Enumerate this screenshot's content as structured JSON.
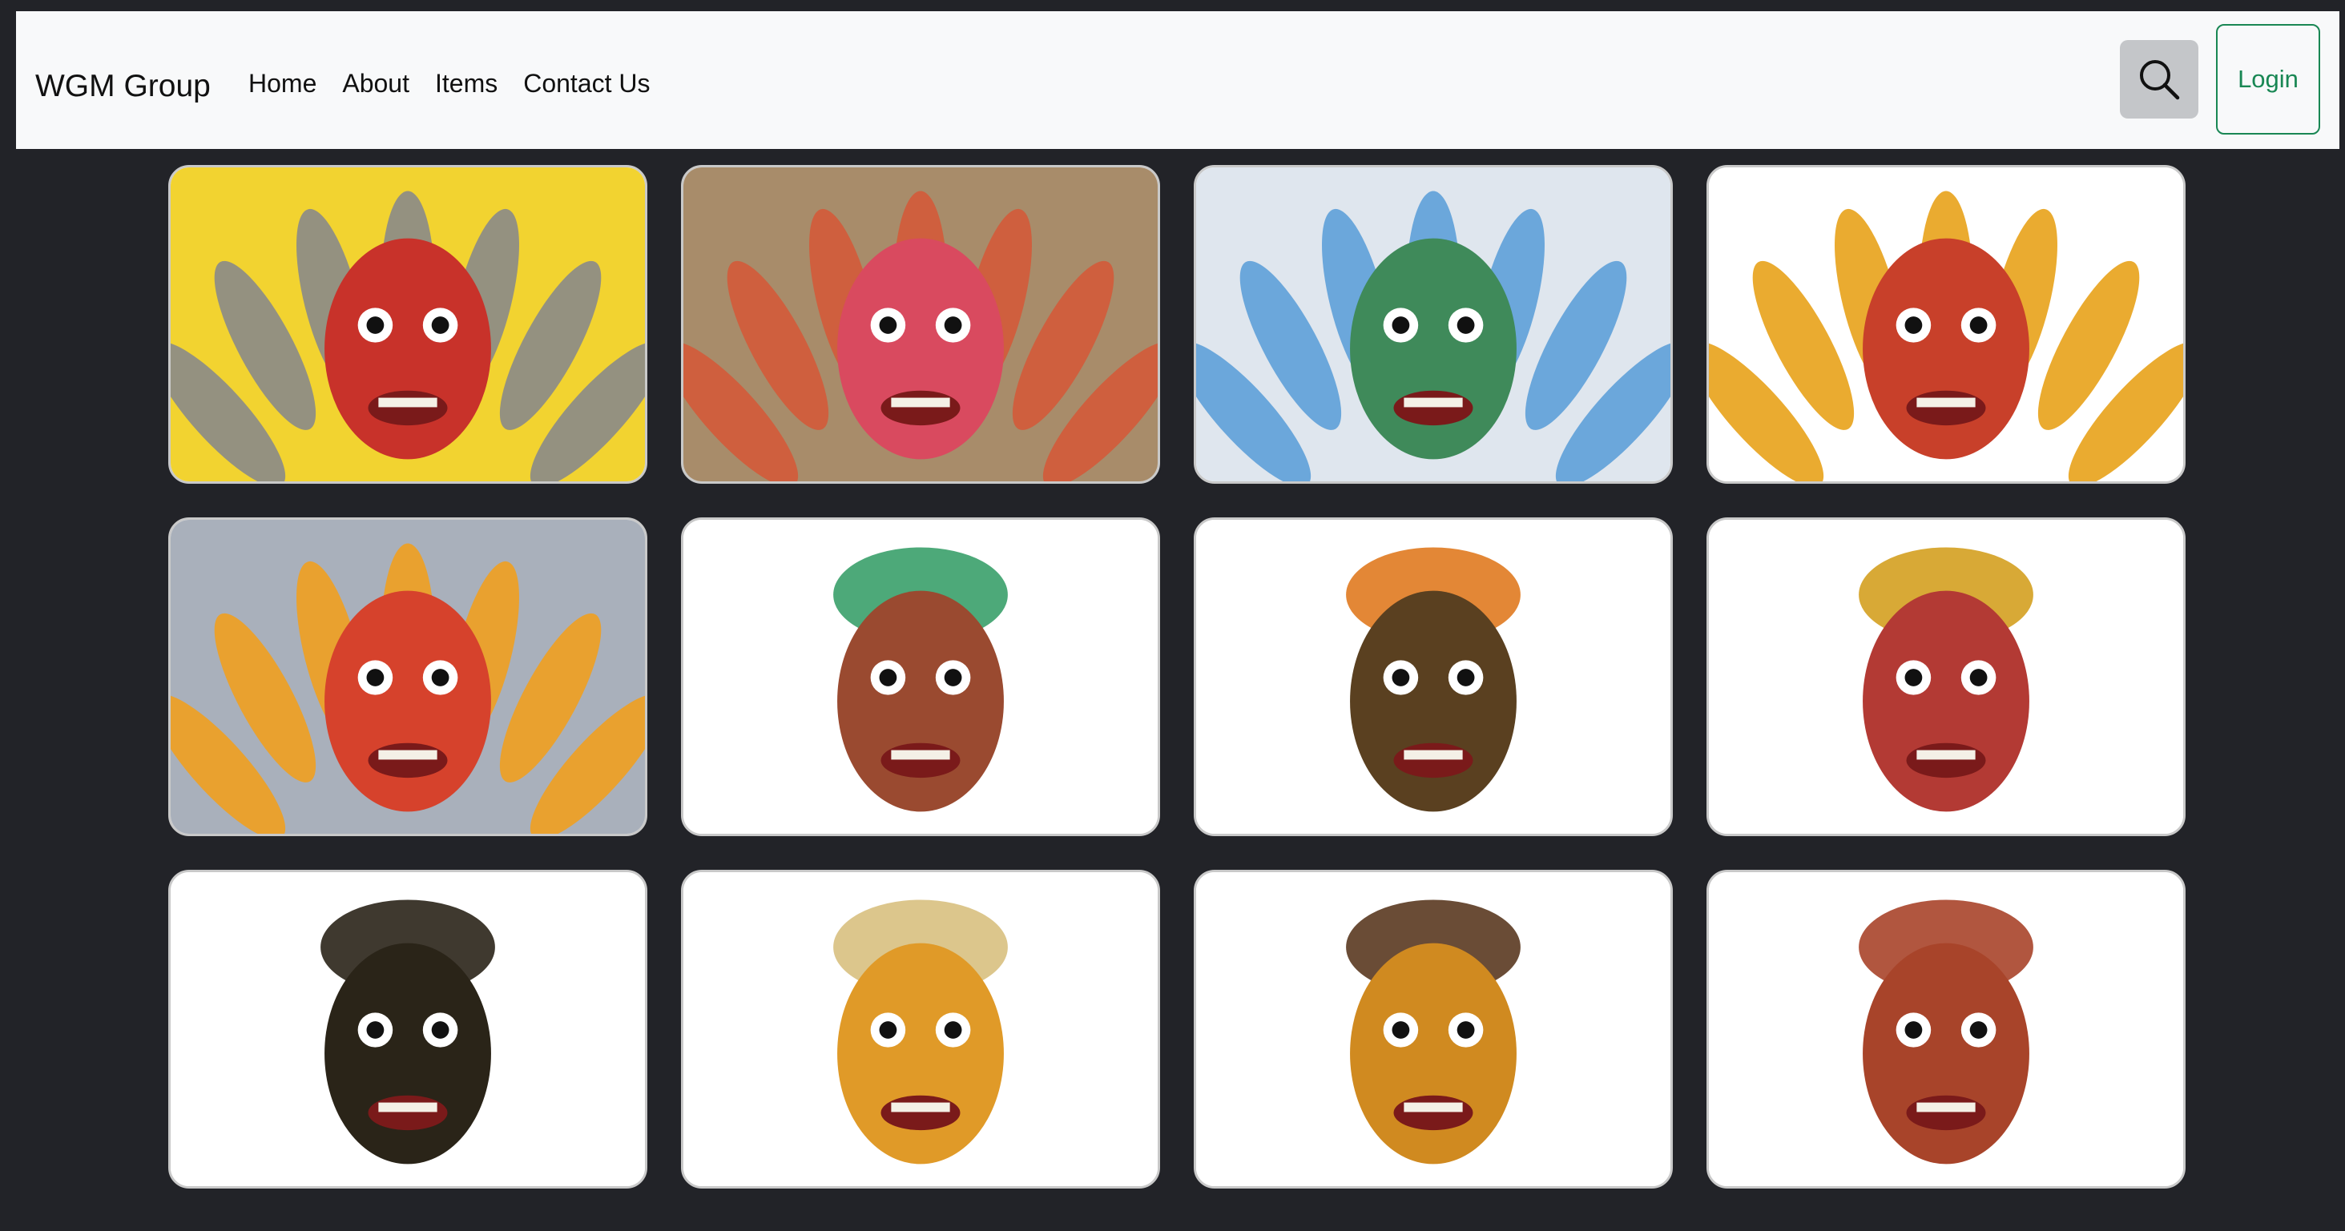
{
  "navbar": {
    "brand": "WGM Group",
    "links": [
      "Home",
      "About",
      "Items",
      "Contact Us"
    ],
    "login_label": "Login"
  },
  "colors": {
    "navbar_bg": "#f8f9fa",
    "page_bg": "#222328",
    "login_accent": "#198754",
    "search_bg": "#c4c6c9"
  },
  "icons": {
    "search": "search-icon"
  },
  "gallery": {
    "items": [
      {
        "name": "mask-1",
        "bg": "#f2d330",
        "face": "#c8322a",
        "crown": "#8a8a8a"
      },
      {
        "name": "mask-2",
        "bg": "#a88c6a",
        "face": "#d94a5f",
        "crown": "#d35a3a"
      },
      {
        "name": "mask-3",
        "bg": "#dfe6ee",
        "face": "#3f8a5a",
        "crown": "#5ea0d8"
      },
      {
        "name": "mask-4",
        "bg": "#ffffff",
        "face": "#c8402a",
        "crown": "#e8a21a"
      },
      {
        "name": "mask-5",
        "bg": "#a9b0bb",
        "face": "#d6422c",
        "crown": "#f0a020"
      },
      {
        "name": "mask-6",
        "bg": "#ffffff",
        "face": "#9a4a30",
        "crown": "#3aa06a"
      },
      {
        "name": "mask-7",
        "bg": "#ffffff",
        "face": "#5a4020",
        "crown": "#e07a20"
      },
      {
        "name": "mask-8",
        "bg": "#ffffff",
        "face": "#b33a34",
        "crown": "#d4a020"
      },
      {
        "name": "mask-9",
        "bg": "#ffffff",
        "face": "#2a2418",
        "crown": "#2a2418"
      },
      {
        "name": "mask-10",
        "bg": "#ffffff",
        "face": "#e09a28",
        "crown": "#d8c080"
      },
      {
        "name": "mask-11",
        "bg": "#ffffff",
        "face": "#d08a20",
        "crown": "#5a3820"
      },
      {
        "name": "mask-12",
        "bg": "#ffffff",
        "face": "#a8442a",
        "crown": "#a8442a"
      }
    ]
  }
}
